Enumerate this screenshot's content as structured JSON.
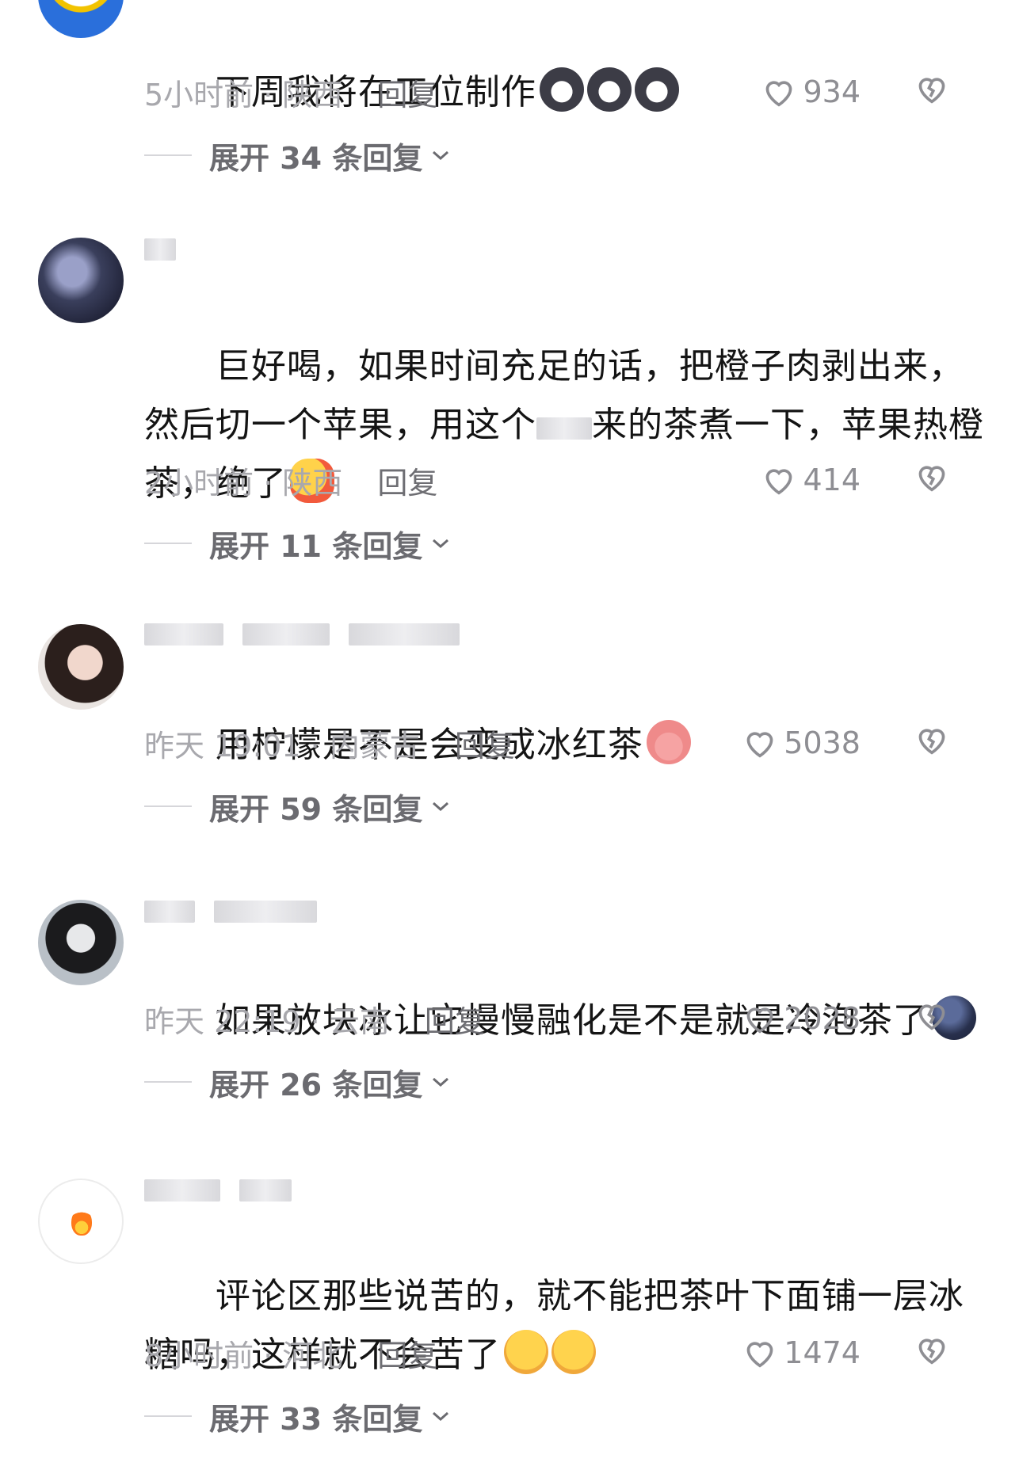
{
  "comments": [
    {
      "text": "下周我将在工位制作",
      "emoji": [
        "cat-face-emoji",
        "cat-face-emoji",
        "cat-face-emoji"
      ],
      "time_location": "5小时前 · 陕西",
      "reply_label": "回复",
      "likes": "934",
      "expand_label": "展开 34 条回复"
    },
    {
      "text": "巨好喝，如果时间充足的话，把橙子肉剥出来，然后切一个苹果，用这个",
      "text_after_blur": "来的茶煮一下，苹果热橙茶，绝了",
      "emoji": [
        "thumbs-up-emoji"
      ],
      "time_location": "2小时前 · 陕西",
      "reply_label": "回复",
      "likes": "414",
      "expand_label": "展开 11 条回复"
    },
    {
      "text": "用柠檬是不是会变成冰红茶",
      "emoji": [
        "pig-face-emoji"
      ],
      "time_location": "昨天 19:01 · 内蒙古",
      "reply_label": "回复",
      "likes": "5038",
      "expand_label": "展开 59 条回复"
    },
    {
      "text": "如果放块冰让它慢慢融化是不是就是冷泡茶了",
      "emoji": [
        "dark-moon-face-emoji"
      ],
      "time_location": "昨天 22:19 · 云南",
      "reply_label": "回复",
      "likes": "2028",
      "expand_label": "展开 26 条回复"
    },
    {
      "text": "评论区那些说苦的，就不能把茶叶下面铺一层冰糖吗，这样就不会苦了",
      "emoji": [
        "thinking-face-emoji",
        "thinking-face-emoji"
      ],
      "time_location": "8小时前 · 河北",
      "reply_label": "回复",
      "likes": "1474",
      "expand_label": "展开 33 条回复"
    }
  ],
  "icons": {
    "like": "heart-outline-icon",
    "dislike": "broken-heart-icon",
    "expand": "chevron-down-icon"
  },
  "colors": {
    "text": "#141414",
    "meta": "#a8a8ad",
    "reply": "#6e6e73",
    "expand": "#6b6b70"
  }
}
